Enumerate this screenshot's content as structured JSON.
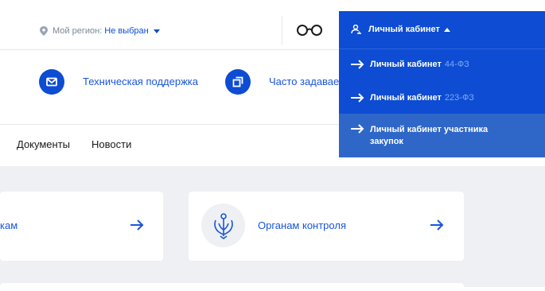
{
  "header": {
    "region_label": "Мой регион:",
    "region_value": "Не выбран",
    "glasses_icon": "glasses-icon"
  },
  "support": {
    "tech_support": "Техническая поддержка",
    "faq": "Часто задаваемые вопросы"
  },
  "nav": {
    "documents": "Документы",
    "news": "Новости"
  },
  "cards": {
    "card1": "кам",
    "card2": "Органам контроля"
  },
  "cabinet_menu": {
    "title": "Личный кабинет",
    "items": [
      {
        "label": "Личный кабинет",
        "suffix": "44-ФЗ"
      },
      {
        "label": "Личный кабинет",
        "suffix": "223-ФЗ"
      },
      {
        "label": "Личный кабинет участника закупок",
        "suffix": ""
      }
    ]
  },
  "colors": {
    "brand_blue": "#0d4cd3",
    "highlight_item": "#2f67c9",
    "grey_bg": "#eef0f3"
  }
}
